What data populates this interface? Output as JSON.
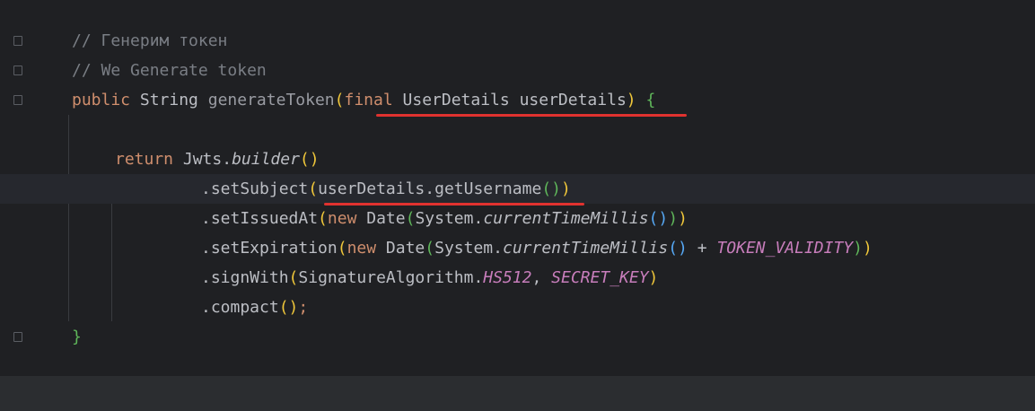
{
  "comments": {
    "line1": "// Генерим токен",
    "line2": "// We Generate token"
  },
  "signature": {
    "kw_public": "public",
    "type_string": "String",
    "method_name": "generateToken",
    "paren_open": "(",
    "kw_final": "final",
    "param_type": "UserDetails",
    "param_name": "userDetails",
    "paren_close": ")",
    "brace_open": "{"
  },
  "body": {
    "kw_return": "return",
    "builder_obj": "Jwts.",
    "builder_call": "builder",
    "builder_parens": "()",
    "set_subject": ".setSubject",
    "subject_arg": "userDetails.getUsername",
    "set_issued_at": ".setIssuedAt",
    "set_expiration": ".setExpiration",
    "kw_new": "new",
    "date_class": "Date",
    "system_obj": "System.",
    "current_time": "currentTimeMillis",
    "plus": "+",
    "token_validity": "TOKEN_VALIDITY",
    "sign_with": ".signWith",
    "sig_alg": "SignatureAlgorithm.",
    "hs512": "HS512",
    "comma": ",",
    "secret_key": "SECRET_KEY",
    "compact": ".compact",
    "semicolon": ";",
    "brace_close": "}"
  },
  "colors": {
    "background": "#1f2023",
    "keyword": "#cf8e6d",
    "comment": "#7a7e85",
    "constant": "#c77dbb",
    "underline": "#e0322f",
    "bulb": "#f2c14e"
  },
  "icons": [
    "fold-marker-icon",
    "lightbulb-icon"
  ]
}
